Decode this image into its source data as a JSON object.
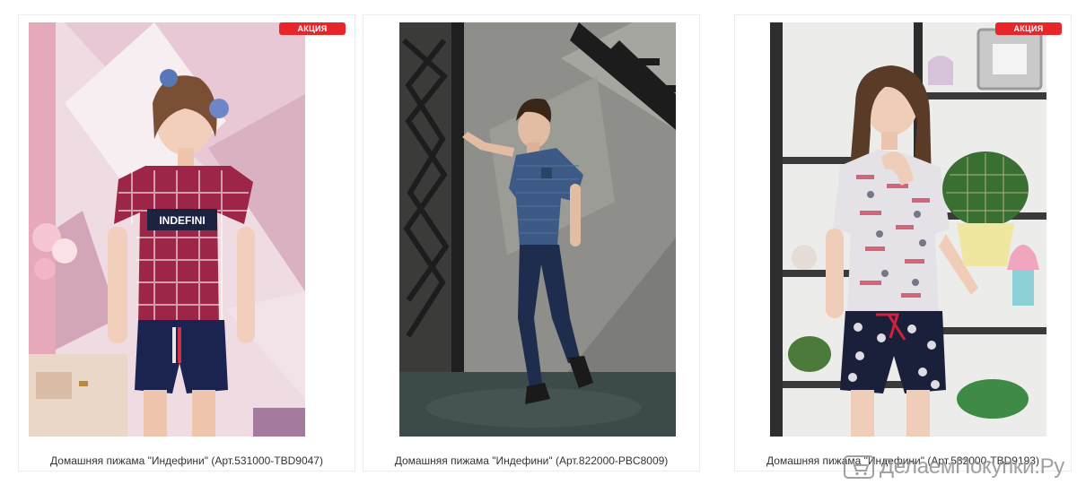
{
  "products": [
    {
      "title": "Домашняя пижама \"Индефини\" (Арт.531000-TBD9047)",
      "badge": "АКЦИЯ",
      "shirt_print": "INDEFINI"
    },
    {
      "title": "Домашняя пижама \"Индефини\" (Арт.822000-PBC8009)",
      "badge": ""
    },
    {
      "title": "Домашняя пижама \"Индефини\" (Арт.532000-TBD9193)",
      "badge": "АКЦИЯ"
    }
  ],
  "watermark": {
    "text": "ДелаемПокупки.Ру"
  },
  "colors": {
    "badge": "#e8262a",
    "card_border": "#ececec",
    "title_text": "#333333"
  }
}
